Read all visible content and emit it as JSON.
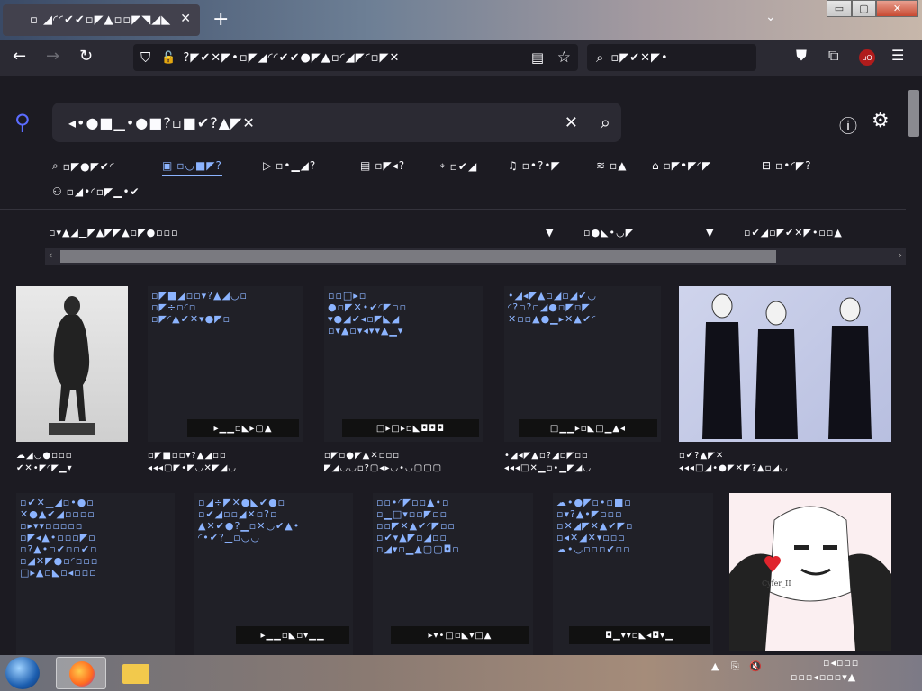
{
  "browser": {
    "tab_title": "▫ ◢◜◜✔✔▫◤▲▫▫◤◥◢◣",
    "url": "?◤✔✕◤•▫◤◢◜◜✔✔●◤▲▫◜◢◤◜▫◤✕",
    "search_placeholder": "▫◤✔✕◤•",
    "window_controls": [
      "▭",
      "▢",
      "✕"
    ]
  },
  "page": {
    "query": "◂•●■▁•●■?▫■✔?▲◤✕",
    "categories": [
      {
        "label": "▫◤●◤✔◜",
        "icon": "search-icon",
        "active": false
      },
      {
        "label": "▫◡■◤?",
        "icon": "image-icon",
        "active": true
      },
      {
        "label": "▫•▁◢?",
        "icon": "video-icon",
        "active": false
      },
      {
        "label": "▫◤◂?",
        "icon": "news-icon",
        "active": false
      },
      {
        "label": "▫✔◢",
        "icon": "map-pin-icon",
        "active": false
      },
      {
        "label": "▫•?•◤",
        "icon": "music-icon",
        "active": false
      },
      {
        "label": "▫▲",
        "icon": "layers-icon",
        "active": false
      },
      {
        "label": "▫◤•◤◜◤",
        "icon": "school-icon",
        "active": false
      },
      {
        "label": "▫•◜◤?",
        "icon": "box-icon",
        "active": false
      },
      {
        "label": "▫◢•◜▫◤▁•✔",
        "icon": "people-icon",
        "active": false
      }
    ],
    "filters": [
      "▫▾▲◢▁◤▲◤◤▲▫◤●▫▫▫",
      "▫●◣•◡◤",
      "▫✔◢▫◤✔✕◤•▫▫▲"
    ],
    "results_row1": [
      {
        "kind": "image",
        "caption_line1": "☁◢◡●▫▫▫",
        "caption_line2": "✔✕•◤◜◤▁▾"
      },
      {
        "kind": "text",
        "title": "▫◤■◢▫▫▾?▲◢◡▫\n▫◤÷▫◜▫\n▫◤◜▲✔✕▾●◤▫",
        "bar": "▸▁▁▫◣▸▢▲",
        "caption_line1": "▫◤■▫▫▾?▲◢▫▫",
        "caption_line2": "◂◂◂▢◤•◤◡✕◤◢◡"
      },
      {
        "kind": "text",
        "title": "▫▫□▸▫\n●▫◤✕•✔◜◤▫▫\n▾●◢✔◂▫◤◣◢\n▫▾▲▫▾◂▾▾▲▁▾",
        "bar": "□▸□▸▫◣◘◘◘",
        "caption_line1": "▫◤▫●◤▲✕▫▫▫",
        "caption_line2": "◤◢◡◡▫?▢◂▸◡•◡▢▢▢"
      },
      {
        "kind": "text",
        "title": "•◢◂◤▲▫◢▫◢✔◡\n◜?▫?▫◢●▫◤▫◤\n✕▫▫▲●▁▸✕▲✔◜",
        "bar": "□▁▁▸▫◣□▁▲◂",
        "caption_line1": "•◢◂◤▲▫?◢▫◤▫▫",
        "caption_line2": "◂◂◂□✕▁▫•▁◤◢◡"
      },
      {
        "kind": "image",
        "caption_line1": "▫✔?▲◤✕",
        "caption_line2": "◂◂◂□◢•●◤✕◤?▲▫◢◡"
      }
    ],
    "results_row2": [
      {
        "kind": "text",
        "title": "▫✔✕▁◢▫•●▫\n✕●▲✔◢▫▫▫▫\n▫▸▾▾▫▫▫▫▫\n▫◤◂▲•▫▫▫◤▫\n▫?▲•▫✔▫▫✔▫\n▫◢✕◤●▫◜▫▫▫\n□▸▲▫◣▫◂▫▫▫",
        "bar": "",
        "caption_line1": "",
        "caption_line2": ""
      },
      {
        "kind": "text",
        "title": "▫◢÷◤✕●◣✔●▫\n▫✔◢▫▫◢✕▫?▫\n▲✕✔●?▁▫✕◡✔▲•\n◜•✔?▁▫◡◡",
        "bar": "▸▁▁▫◣▫▾▁▁",
        "caption_line1": "",
        "caption_line2": ""
      },
      {
        "kind": "text",
        "title": "▫▫•◜◤▫▫▲•▫\n▫▁□▾▫▫◤▫▫\n▫▫◤✕▲✔◜◤▫▫\n▫✔▾▲◤▫◢▫▫\n▫◢▾▫▁▲▢▢◘▫",
        "bar": "▸▾•□▫◣▾□▲",
        "caption_line1": "",
        "caption_line2": ""
      },
      {
        "kind": "text",
        "title": "☁•●◤▫•▫■▫\n▫▾?▲•◤▫▫▫\n▫✕◢◤✕▲✔◤▫\n▫◂✕◢✕▾▫▫▫\n☁•◡▫▫▫✔▫▫",
        "bar": "◘▁▾▾▫◣◂◘▾▁",
        "caption_line1": "",
        "caption_line2": ""
      },
      {
        "kind": "image",
        "caption_line1": "",
        "caption_line2": ""
      }
    ],
    "drawing_signature": "Cyfer_II"
  },
  "taskbar": {
    "tray_text": "▫◂▫▫▫",
    "date_text": "▫▫▫◂▫▫▫▾▲"
  },
  "colors": {
    "accent": "#8cb4ff",
    "bg": "#1c1b22",
    "toolbar": "#2b2a33"
  }
}
